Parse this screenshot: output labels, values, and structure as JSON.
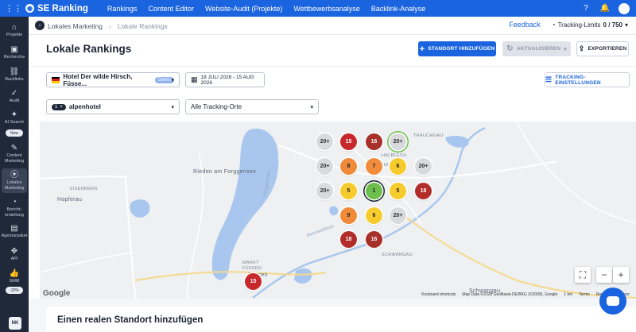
{
  "topbar": {
    "brand": "SE Ranking",
    "nav": [
      "Rankings",
      "Content Editor",
      "Website-Audit (Projekte)",
      "Wettbewerbsanalyse",
      "Backlink-Analyse"
    ]
  },
  "sidebar": {
    "items": [
      {
        "label": "Projekte",
        "icon": "home-icon",
        "glyph": "⌂"
      },
      {
        "label": "Recherche",
        "icon": "research-icon",
        "glyph": "▣"
      },
      {
        "label": "Backlinks",
        "icon": "link-icon",
        "glyph": "⛓"
      },
      {
        "label": "Audit",
        "icon": "audit-icon",
        "glyph": "✓"
      },
      {
        "label": "AI Search",
        "icon": "sparkle-icon",
        "glyph": "✦"
      },
      {
        "label": "Content Marketing",
        "icon": "edit-icon",
        "glyph": "✎"
      },
      {
        "label": "Lokales Marketing",
        "icon": "location-pin-icon",
        "glyph": "⦿"
      },
      {
        "label": "Bericht-erstellung",
        "icon": "report-icon",
        "glyph": "◔"
      },
      {
        "label": "Agenturpaket",
        "icon": "building-icon",
        "glyph": "▤"
      },
      {
        "label": "API",
        "icon": "api-icon",
        "glyph": "✥"
      },
      {
        "label": "SMM",
        "icon": "thumbs-up-icon",
        "glyph": "👍"
      }
    ],
    "new_badge": "New",
    "smm_badge": "-20%",
    "avatar": "NK"
  },
  "header": {
    "breadcrumb": [
      "Lokales Marketing",
      "Lokale Rankings"
    ],
    "feedback": "Feedback",
    "tracking_label": "Tracking-Limits",
    "tracking_value": "0 / 750"
  },
  "page": {
    "title": "Lokale Rankings",
    "add_location": "STANDORT HINZUFÜGEN",
    "refresh": "AKTUALISIEREN",
    "export": "EXPORTIEREN",
    "tracking_settings": "TRACKING-EINSTELLUNGEN"
  },
  "filters": {
    "business": "Hotel Der wilde Hirsch, Füsse...",
    "demo_badge": "Demo",
    "date_range": "18 JULI 2026 - 15 AUG 2026",
    "keyword_count": "1",
    "keyword": "alpenhotel",
    "locations": "Alle Tracking-Orte"
  },
  "map": {
    "labels": [
      "Rieden am Forggensee",
      "Hopferau",
      "Füssen",
      "Schwangau",
      "Forggensee",
      "Bannwaldsee",
      "EISENBERG",
      "HALBLECH",
      "MARKT",
      "FÜSSEN",
      "SCHWANGAU",
      "BUCHING",
      "TRAUCHGAU"
    ],
    "pins": [
      {
        "value": "20+",
        "color": "#d8dadd"
      },
      {
        "value": "15",
        "color": "#c6282b"
      },
      {
        "value": "16",
        "color": "#a8302a"
      },
      {
        "value": "20+",
        "color": "#d8dadd"
      },
      {
        "value": "20+",
        "color": "#d8dadd"
      },
      {
        "value": "8",
        "color": "#ee8a3a"
      },
      {
        "value": "7",
        "color": "#f08c3c"
      },
      {
        "value": "6",
        "color": "#f6cb2e"
      },
      {
        "value": "20+",
        "color": "#d8dadd"
      },
      {
        "value": "20+",
        "color": "#d8dadd"
      },
      {
        "value": "5",
        "color": "#f6cb2e"
      },
      {
        "value": "1",
        "color": "#6cbf4c"
      },
      {
        "value": "5",
        "color": "#f6cb2e"
      },
      {
        "value": "18",
        "color": "#b22d2a"
      },
      {
        "value": "9",
        "color": "#ee8a3a"
      },
      {
        "value": "6",
        "color": "#f6cb2e"
      },
      {
        "value": "20+",
        "color": "#d8dadd"
      },
      {
        "value": "18",
        "color": "#b22d2a"
      },
      {
        "value": "16",
        "color": "#a8302a"
      },
      {
        "value": "15",
        "color": "#c6282b"
      }
    ],
    "google": "Google",
    "footer": [
      "Keyboard shortcuts",
      "Map Data ©2026 GeoBasis-DE/BKG (©2009), Google",
      "1 km",
      "Terms",
      "Report a map error"
    ]
  },
  "card": {
    "title": "Einen realen Standort hinzufügen"
  }
}
